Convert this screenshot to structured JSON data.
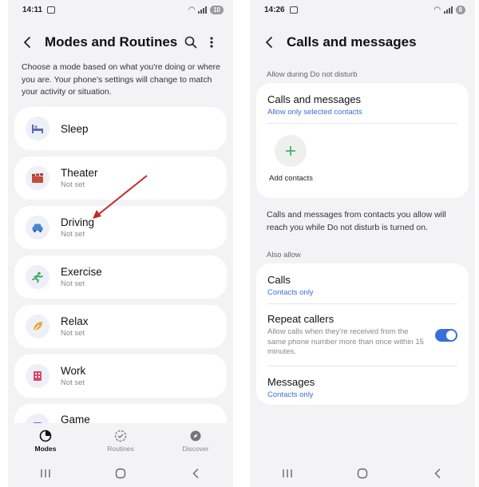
{
  "left": {
    "status": {
      "time": "14:11",
      "battery": "10"
    },
    "header": {
      "title": "Modes and Routines"
    },
    "intro": "Choose a mode based on what you're doing or where you are. Your phone's settings will change to match your activity or situation.",
    "modes": [
      {
        "name": "Sleep",
        "status": "",
        "icon": "bed-icon"
      },
      {
        "name": "Theater",
        "status": "Not set",
        "icon": "clapperboard-icon"
      },
      {
        "name": "Driving",
        "status": "Not set",
        "icon": "car-icon"
      },
      {
        "name": "Exercise",
        "status": "Not set",
        "icon": "running-icon"
      },
      {
        "name": "Relax",
        "status": "Not set",
        "icon": "leaf-icon"
      },
      {
        "name": "Work",
        "status": "Not set",
        "icon": "building-icon"
      },
      {
        "name": "Game",
        "status": "",
        "icon": "gamepad-icon"
      }
    ],
    "nav": [
      {
        "label": "Modes",
        "active": true
      },
      {
        "label": "Routines",
        "active": false
      },
      {
        "label": "Discover",
        "active": false
      }
    ]
  },
  "right": {
    "status": {
      "time": "14:26",
      "battery": "8"
    },
    "header": {
      "title": "Calls and messages"
    },
    "section_allow_dnd": "Allow during Do not disturb",
    "calls_messages": {
      "title": "Calls and messages",
      "subtitle": "Allow only selected contacts"
    },
    "add_contacts_label": "Add contacts",
    "info": "Calls and messages from contacts you allow will reach you while Do not disturb is turned on.",
    "section_also_allow": "Also allow",
    "calls": {
      "title": "Calls",
      "subtitle": "Contacts only"
    },
    "repeat_callers": {
      "title": "Repeat callers",
      "description": "Allow calls when they're received from the same phone number more than once within 15 minutes.",
      "enabled": true
    },
    "messages": {
      "title": "Messages",
      "subtitle": "Contacts only"
    }
  },
  "colors": {
    "accent": "#3a6fd8",
    "annotation_arrow": "#c62828",
    "background": "#f3f3f5"
  }
}
